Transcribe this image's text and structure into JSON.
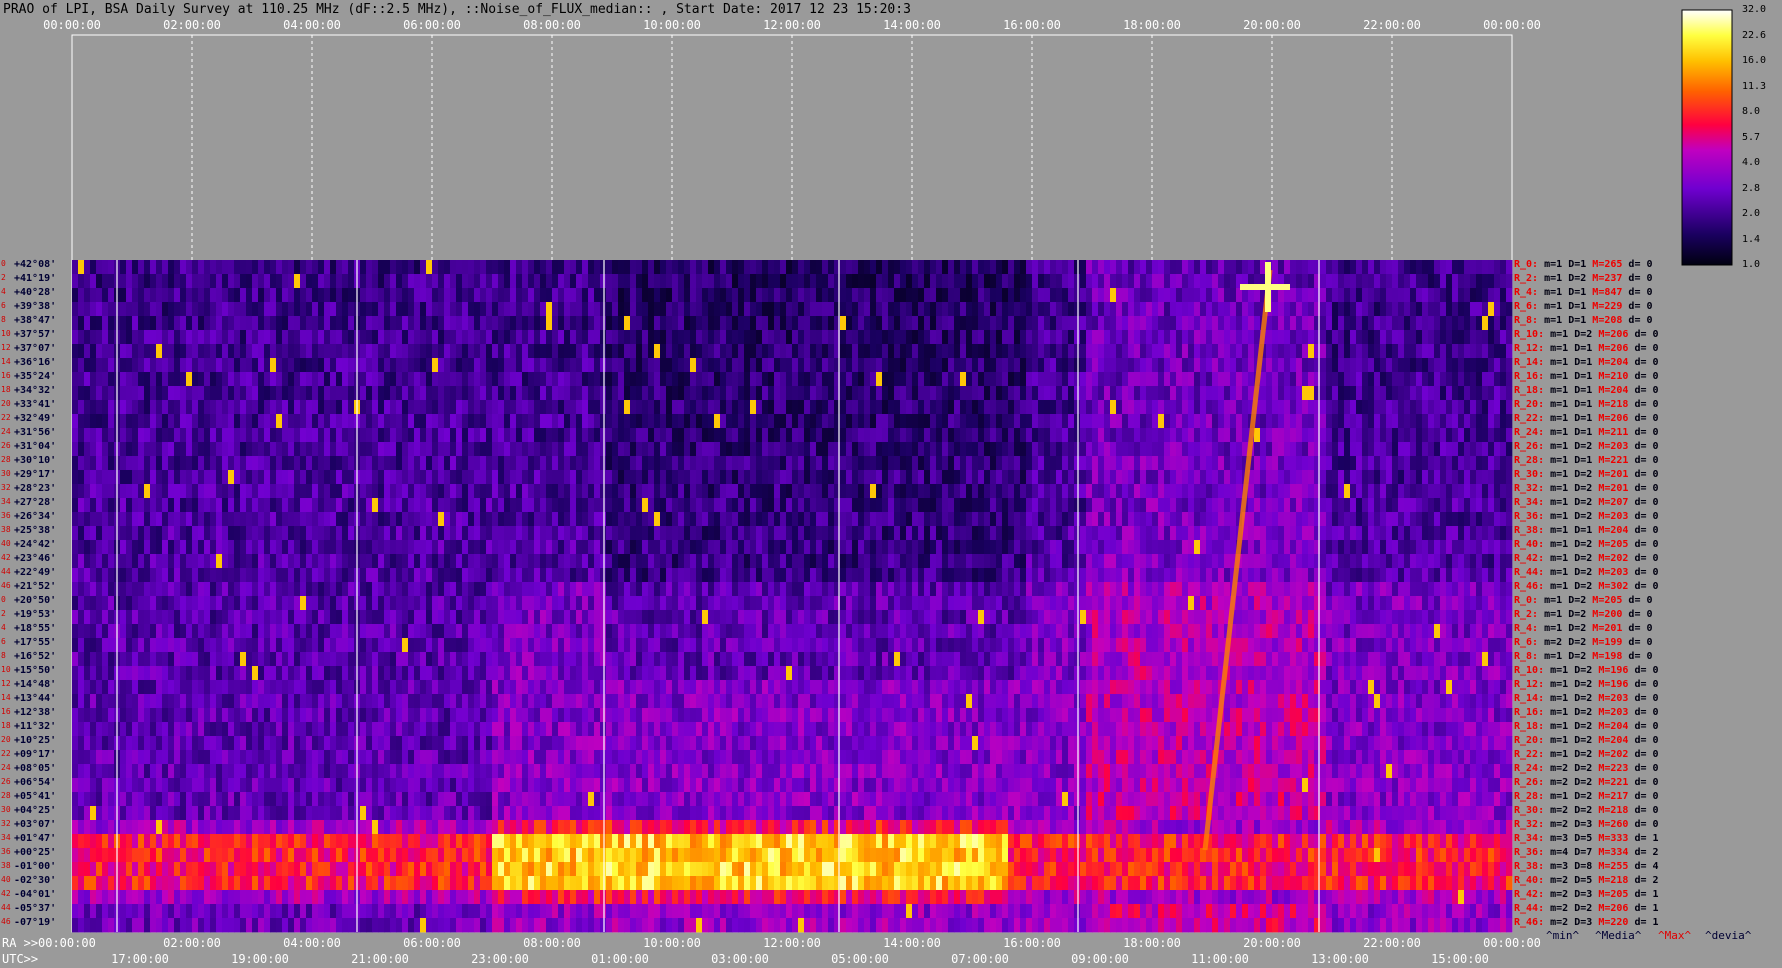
{
  "title": "PRAO of LPI, BSA Daily Survey at 110.25 MHz (dF::2.5 MHz), ::Noise_of_FLUX_median:: , Start Date: 2017 12 23 15:20:3",
  "chart_data": {
    "type": "heatmap",
    "top_ticks": [
      "00:00:00",
      "02:00:00",
      "04:00:00",
      "06:00:00",
      "08:00:00",
      "10:00:00",
      "12:00:00",
      "14:00:00",
      "16:00:00",
      "18:00:00",
      "20:00:00",
      "22:00:00",
      "00:00:00"
    ],
    "ra_prefix": "RA >>",
    "ra_ticks": [
      "00:00:00",
      "02:00:00",
      "04:00:00",
      "06:00:00",
      "08:00:00",
      "10:00:00",
      "12:00:00",
      "14:00:00",
      "16:00:00",
      "18:00:00",
      "20:00:00",
      "22:00:00",
      "00:00:00"
    ],
    "utc_prefix": "UTC>>",
    "utc_ticks": [
      "17:00:00",
      "19:00:00",
      "21:00:00",
      "23:00:00",
      "01:00:00",
      "03:00:00",
      "05:00:00",
      "07:00:00",
      "09:00:00",
      "11:00:00",
      "13:00:00",
      "15:00:00"
    ],
    "colorbar_ticks": [
      "32.0",
      "22.6",
      "16.0",
      "11.3",
      "8.0",
      "5.7",
      "4.0",
      "2.8",
      "2.0",
      "1.4",
      "1.0"
    ],
    "declinations": [
      "+42°08'",
      "+41°19'",
      "+40°28'",
      "+39°38'",
      "+38°47'",
      "+37°57'",
      "+37°07'",
      "+36°16'",
      "+35°24'",
      "+34°32'",
      "+33°41'",
      "+32°49'",
      "+31°56'",
      "+31°04'",
      "+30°10'",
      "+29°17'",
      "+28°23'",
      "+27°28'",
      "+26°34'",
      "+25°38'",
      "+24°42'",
      "+23°46'",
      "+22°49'",
      "+21°52'",
      "+20°50'",
      "+19°53'",
      "+18°55'",
      "+17°55'",
      "+16°52'",
      "+15°50'",
      "+14°48'",
      "+13°44'",
      "+12°38'",
      "+11°32'",
      "+10°25'",
      "+09°17'",
      "+08°05'",
      "+06°54'",
      "+05°41'",
      "+04°25'",
      "+03°07'",
      "+01°47'",
      "+00°25'",
      "-01°00'",
      "-02°30'",
      "-04°01'",
      "-05°37'",
      "-07°19'"
    ],
    "row_stats": [
      [
        "R_0:",
        "m=1",
        "D=1",
        "M=265",
        "d= 0"
      ],
      [
        "R_2:",
        "m=1",
        "D=2",
        "M=237",
        "d= 0"
      ],
      [
        "R_4:",
        "m=1",
        "D=1",
        "M=847",
        "d= 0"
      ],
      [
        "R_6:",
        "m=1",
        "D=1",
        "M=229",
        "d= 0"
      ],
      [
        "R_8:",
        "m=1",
        "D=1",
        "M=208",
        "d= 0"
      ],
      [
        "R_10:",
        "m=1",
        "D=2",
        "M=206",
        "d= 0"
      ],
      [
        "R_12:",
        "m=1",
        "D=1",
        "M=206",
        "d= 0"
      ],
      [
        "R_14:",
        "m=1",
        "D=1",
        "M=204",
        "d= 0"
      ],
      [
        "R_16:",
        "m=1",
        "D=1",
        "M=210",
        "d= 0"
      ],
      [
        "R_18:",
        "m=1",
        "D=1",
        "M=204",
        "d= 0"
      ],
      [
        "R_20:",
        "m=1",
        "D=1",
        "M=218",
        "d= 0"
      ],
      [
        "R_22:",
        "m=1",
        "D=1",
        "M=206",
        "d= 0"
      ],
      [
        "R_24:",
        "m=1",
        "D=1",
        "M=211",
        "d= 0"
      ],
      [
        "R_26:",
        "m=1",
        "D=2",
        "M=203",
        "d= 0"
      ],
      [
        "R_28:",
        "m=1",
        "D=1",
        "M=221",
        "d= 0"
      ],
      [
        "R_30:",
        "m=1",
        "D=2",
        "M=201",
        "d= 0"
      ],
      [
        "R_32:",
        "m=1",
        "D=2",
        "M=201",
        "d= 0"
      ],
      [
        "R_34:",
        "m=1",
        "D=2",
        "M=207",
        "d= 0"
      ],
      [
        "R_36:",
        "m=1",
        "D=2",
        "M=203",
        "d= 0"
      ],
      [
        "R_38:",
        "m=1",
        "D=1",
        "M=204",
        "d= 0"
      ],
      [
        "R_40:",
        "m=1",
        "D=2",
        "M=205",
        "d= 0"
      ],
      [
        "R_42:",
        "m=1",
        "D=2",
        "M=202",
        "d= 0"
      ],
      [
        "R_44:",
        "m=1",
        "D=2",
        "M=203",
        "d= 0"
      ],
      [
        "R_46:",
        "m=1",
        "D=2",
        "M=302",
        "d= 0"
      ],
      [
        "R_0:",
        "m=1",
        "D=2",
        "M=205",
        "d= 0"
      ],
      [
        "R_2:",
        "m=1",
        "D=2",
        "M=200",
        "d= 0"
      ],
      [
        "R_4:",
        "m=1",
        "D=2",
        "M=201",
        "d= 0"
      ],
      [
        "R_6:",
        "m=2",
        "D=2",
        "M=199",
        "d= 0"
      ],
      [
        "R_8:",
        "m=1",
        "D=2",
        "M=198",
        "d= 0"
      ],
      [
        "R_10:",
        "m=1",
        "D=2",
        "M=196",
        "d= 0"
      ],
      [
        "R_12:",
        "m=1",
        "D=2",
        "M=196",
        "d= 0"
      ],
      [
        "R_14:",
        "m=1",
        "D=2",
        "M=203",
        "d= 0"
      ],
      [
        "R_16:",
        "m=1",
        "D=2",
        "M=203",
        "d= 0"
      ],
      [
        "R_18:",
        "m=1",
        "D=2",
        "M=204",
        "d= 0"
      ],
      [
        "R_20:",
        "m=1",
        "D=2",
        "M=204",
        "d= 0"
      ],
      [
        "R_22:",
        "m=1",
        "D=2",
        "M=202",
        "d= 0"
      ],
      [
        "R_24:",
        "m=2",
        "D=2",
        "M=223",
        "d= 0"
      ],
      [
        "R_26:",
        "m=2",
        "D=2",
        "M=221",
        "d= 0"
      ],
      [
        "R_28:",
        "m=1",
        "D=2",
        "M=217",
        "d= 0"
      ],
      [
        "R_30:",
        "m=2",
        "D=2",
        "M=218",
        "d= 0"
      ],
      [
        "R_32:",
        "m=2",
        "D=3",
        "M=260",
        "d= 0"
      ],
      [
        "R_34:",
        "m=3",
        "D=5",
        "M=333",
        "d= 1"
      ],
      [
        "R_36:",
        "m=4",
        "D=7",
        "M=334",
        "d= 2"
      ],
      [
        "R_38:",
        "m=3",
        "D=8",
        "M=255",
        "d= 4"
      ],
      [
        "R_40:",
        "m=2",
        "D=5",
        "M=218",
        "d= 2"
      ],
      [
        "R_42:",
        "m=2",
        "D=3",
        "M=205",
        "d= 1"
      ],
      [
        "R_44:",
        "m=2",
        "D=2",
        "M=206",
        "d= 1"
      ],
      [
        "R_46:",
        "m=2",
        "D=3",
        "M=220",
        "d= 1"
      ]
    ],
    "legend_words": [
      "^min^",
      "^Media^",
      "^Max^",
      "^devia^"
    ],
    "colors": {
      "background": "#9a9a9a",
      "label_red": "#e00000",
      "label_navy": "#000033"
    }
  }
}
